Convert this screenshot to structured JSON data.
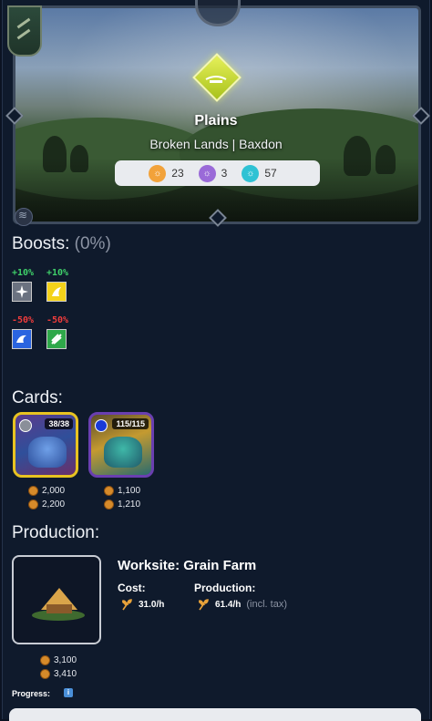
{
  "land": {
    "name": "Plains",
    "region": "Broken Lands | Baxdon",
    "stats": [
      {
        "icon": "orange-resource-icon",
        "value": "23",
        "color": "#f2a23a"
      },
      {
        "icon": "purple-resource-icon",
        "value": "3",
        "color": "#9a6ad8"
      },
      {
        "icon": "teal-resource-icon",
        "value": "57",
        "color": "#2fc2d4"
      }
    ]
  },
  "boosts": {
    "label": "Boosts:",
    "total": "(0%)",
    "items": [
      {
        "pct": "+10%",
        "icon": "neutral-element-icon",
        "color": "#ffffff"
      },
      {
        "pct": "+10%",
        "icon": "life-element-icon",
        "color": "#f4d21a"
      },
      {
        "pct": "-50%",
        "icon": "water-element-icon",
        "color": "#2a64e0"
      },
      {
        "pct": "-50%",
        "icon": "earth-element-icon",
        "color": "#2fa84a"
      }
    ]
  },
  "cards": {
    "label": "Cards:",
    "items": [
      {
        "badge": "38/38",
        "power1": "2,000",
        "power2": "2,200",
        "frame_color": "#e8c321",
        "dot_color": "#8a8f99"
      },
      {
        "badge": "115/115",
        "power1": "1,100",
        "power2": "1,210",
        "frame_color": "#6a3fb0",
        "dot_color": "#1a3ad8"
      }
    ]
  },
  "production": {
    "label": "Production:",
    "worksite": "Worksite: Grain Farm",
    "cost_label": "Cost:",
    "cost_value": "31.0/h",
    "production_label": "Production:",
    "production_value": "61.4/h",
    "production_note": "(incl. tax)",
    "power1": "3,100",
    "power2": "3,410",
    "progress_label": "Progress:",
    "info": "i"
  }
}
